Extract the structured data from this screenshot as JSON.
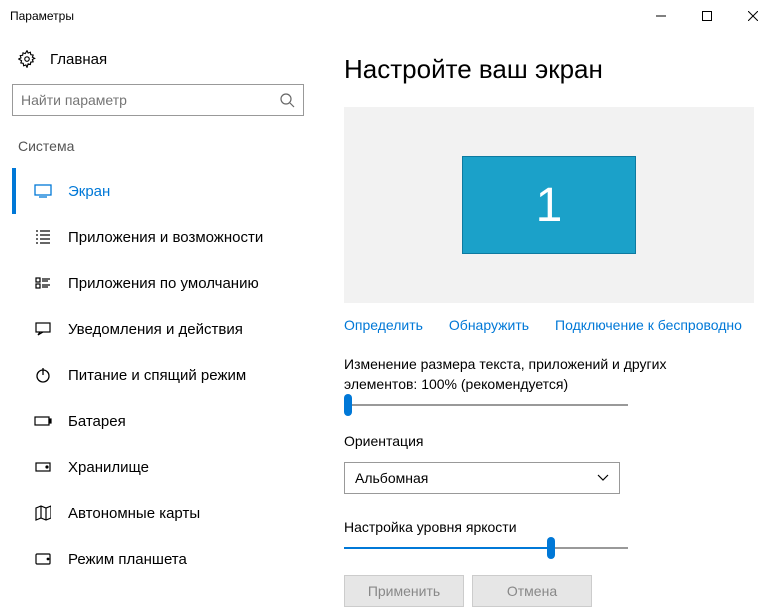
{
  "window": {
    "title": "Параметры"
  },
  "sidebar": {
    "home_label": "Главная",
    "search_placeholder": "Найти параметр",
    "section": "Система",
    "items": [
      {
        "label": "Экран",
        "icon": "display"
      },
      {
        "label": "Приложения и возможности",
        "icon": "apps"
      },
      {
        "label": "Приложения по умолчанию",
        "icon": "default-apps"
      },
      {
        "label": "Уведомления и действия",
        "icon": "notifications"
      },
      {
        "label": "Питание и спящий режим",
        "icon": "power"
      },
      {
        "label": "Батарея",
        "icon": "battery"
      },
      {
        "label": "Хранилище",
        "icon": "storage"
      },
      {
        "label": "Автономные карты",
        "icon": "maps"
      },
      {
        "label": "Режим планшета",
        "icon": "tablet"
      }
    ]
  },
  "main": {
    "title": "Настройте ваш экран",
    "monitor_number": "1",
    "links": {
      "identify": "Определить",
      "detect": "Обнаружить",
      "wireless": "Подключение к беспроводно"
    },
    "scale_label": "Изменение размера текста, приложений и других элементов: 100% (рекомендуется)",
    "orientation_label": "Ориентация",
    "orientation_value": "Альбомная",
    "brightness_label": "Настройка уровня яркости",
    "apply_label": "Применить",
    "cancel_label": "Отмена"
  }
}
